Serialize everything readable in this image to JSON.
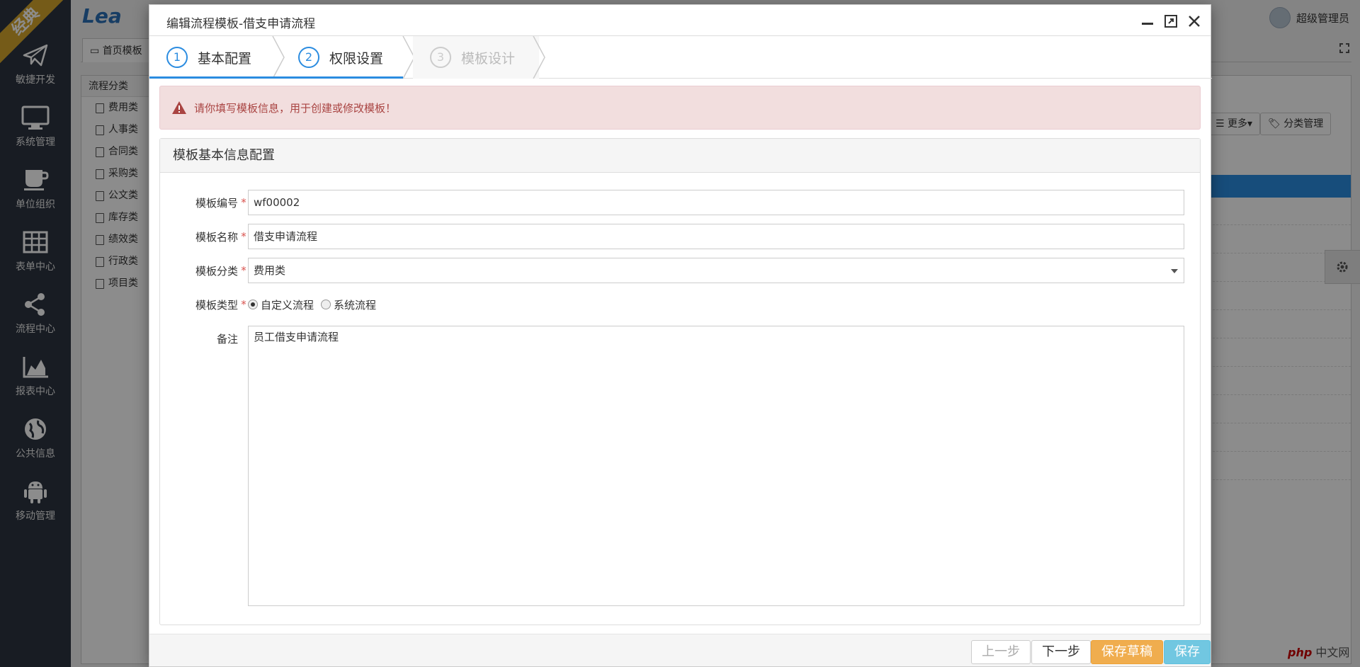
{
  "sidebar": {
    "ribbon": "经典",
    "items": [
      {
        "label": "敏捷开发",
        "icon": "paper-plane-icon"
      },
      {
        "label": "系统管理",
        "icon": "monitor-icon"
      },
      {
        "label": "单位组织",
        "icon": "coffee-cup-icon"
      },
      {
        "label": "表单中心",
        "icon": "table-grid-icon"
      },
      {
        "label": "流程中心",
        "icon": "share-nodes-icon"
      },
      {
        "label": "报表中心",
        "icon": "area-chart-icon"
      },
      {
        "label": "公共信息",
        "icon": "globe-icon"
      },
      {
        "label": "移动管理",
        "icon": "android-icon"
      }
    ]
  },
  "header": {
    "brand": "Lea",
    "user_name": "超级管理员"
  },
  "background": {
    "tab_label": "首页模板",
    "panel_title": "流程分类",
    "categories": [
      "费用类",
      "人事类",
      "合同类",
      "采购类",
      "公文类",
      "库存类",
      "绩效类",
      "行政类",
      "项目类"
    ],
    "more_button": "更多",
    "category_manage_button": "分类管理"
  },
  "modal": {
    "title": "编辑流程模板-借支申请流程",
    "steps": [
      {
        "num": "1",
        "label": "基本配置"
      },
      {
        "num": "2",
        "label": "权限设置"
      },
      {
        "num": "3",
        "label": "模板设计"
      }
    ],
    "alert": "请你填写模板信息，用于创建或修改模板！",
    "section_title": "模板基本信息配置",
    "form": {
      "code_label": "模板编号",
      "code_value": "wf00002",
      "name_label": "模板名称",
      "name_value": "借支申请流程",
      "category_label": "模板分类",
      "category_value": "费用类",
      "type_label": "模板类型",
      "type_custom": "自定义流程",
      "type_system": "系统流程",
      "remark_label": "备注",
      "remark_value": "员工借支申请流程",
      "required_mark": "*"
    },
    "footer": {
      "prev": "上一步",
      "next": "下一步",
      "save_draft": "保存草稿",
      "save": "保存"
    }
  },
  "watermark": {
    "php": "php",
    "site": "中文网"
  },
  "colors": {
    "sidebar_bg": "#2c3440",
    "accent": "#2b8ce0",
    "alert_bg": "#f2dede",
    "alert_text": "#a94442",
    "draft_btn": "#f0ad4e",
    "save_btn": "#5bc0de"
  }
}
